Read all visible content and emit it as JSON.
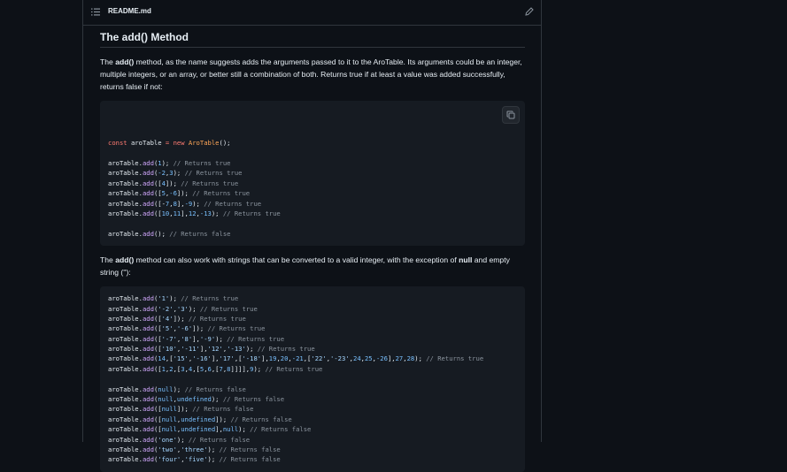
{
  "file": {
    "name": "README.md"
  },
  "section": {
    "title": "The add() Method",
    "para1": {
      "pre": "The ",
      "bold": "add()",
      "post": " method, as the name suggests adds the arguments passed to it to the AroTable. Its arguments could be an integer, multiple integers, or an array, or better still a combination of both. Returns true if at least a value was added successfully, returns false if not:"
    },
    "para2": {
      "pre": "The ",
      "bold": "add()",
      "mid": " method can also work with strings that can be converted to a valid integer, with the exception of ",
      "bold2": "null",
      "post": " and empty string (''):"
    }
  },
  "code1": [
    [
      [
        "k",
        "const"
      ],
      [
        "t",
        " aroTable "
      ],
      [
        "k",
        "="
      ],
      [
        "t",
        " "
      ],
      [
        "k",
        "new"
      ],
      [
        "t",
        " "
      ],
      [
        "cl",
        "AroTable"
      ],
      [
        "t",
        "();"
      ]
    ],
    [],
    [
      [
        "t",
        "aroTable."
      ],
      [
        "f",
        "add"
      ],
      [
        "t",
        "("
      ],
      [
        "n",
        "1"
      ],
      [
        "t",
        "); "
      ],
      [
        "c",
        "// Returns true"
      ]
    ],
    [
      [
        "t",
        "aroTable."
      ],
      [
        "f",
        "add"
      ],
      [
        "t",
        "("
      ],
      [
        "n",
        "-2"
      ],
      [
        "t",
        ","
      ],
      [
        "n",
        "3"
      ],
      [
        "t",
        "); "
      ],
      [
        "c",
        "// Returns true"
      ]
    ],
    [
      [
        "t",
        "aroTable."
      ],
      [
        "f",
        "add"
      ],
      [
        "t",
        "(["
      ],
      [
        "n",
        "4"
      ],
      [
        "t",
        "]); "
      ],
      [
        "c",
        "// Returns true"
      ]
    ],
    [
      [
        "t",
        "aroTable."
      ],
      [
        "f",
        "add"
      ],
      [
        "t",
        "(["
      ],
      [
        "n",
        "5"
      ],
      [
        "t",
        ","
      ],
      [
        "n",
        "-6"
      ],
      [
        "t",
        "]); "
      ],
      [
        "c",
        "// Returns true"
      ]
    ],
    [
      [
        "t",
        "aroTable."
      ],
      [
        "f",
        "add"
      ],
      [
        "t",
        "([-"
      ],
      [
        "n",
        "7"
      ],
      [
        "t",
        ","
      ],
      [
        "n",
        "8"
      ],
      [
        "t",
        "],"
      ],
      [
        "n",
        "-9"
      ],
      [
        "t",
        "); "
      ],
      [
        "c",
        "// Returns true"
      ]
    ],
    [
      [
        "t",
        "aroTable."
      ],
      [
        "f",
        "add"
      ],
      [
        "t",
        "(["
      ],
      [
        "n",
        "10"
      ],
      [
        "t",
        ","
      ],
      [
        "n",
        "11"
      ],
      [
        "t",
        "],"
      ],
      [
        "n",
        "12"
      ],
      [
        "t",
        ","
      ],
      [
        "n",
        "-13"
      ],
      [
        "t",
        "); "
      ],
      [
        "c",
        "// Returns true"
      ]
    ],
    [],
    [
      [
        "t",
        "aroTable."
      ],
      [
        "f",
        "add"
      ],
      [
        "t",
        "(); "
      ],
      [
        "c",
        "// Returns false"
      ]
    ]
  ],
  "code2": [
    [
      [
        "t",
        "aroTable."
      ],
      [
        "f",
        "add"
      ],
      [
        "t",
        "("
      ],
      [
        "s",
        "'1'"
      ],
      [
        "t",
        "); "
      ],
      [
        "c",
        "// Returns true"
      ]
    ],
    [
      [
        "t",
        "aroTable."
      ],
      [
        "f",
        "add"
      ],
      [
        "t",
        "("
      ],
      [
        "s",
        "'-2'"
      ],
      [
        "t",
        ","
      ],
      [
        "s",
        "'3'"
      ],
      [
        "t",
        "); "
      ],
      [
        "c",
        "// Returns true"
      ]
    ],
    [
      [
        "t",
        "aroTable."
      ],
      [
        "f",
        "add"
      ],
      [
        "t",
        "(["
      ],
      [
        "s",
        "'4'"
      ],
      [
        "t",
        "]); "
      ],
      [
        "c",
        "// Returns true"
      ]
    ],
    [
      [
        "t",
        "aroTable."
      ],
      [
        "f",
        "add"
      ],
      [
        "t",
        "(["
      ],
      [
        "s",
        "'5'"
      ],
      [
        "t",
        ","
      ],
      [
        "s",
        "'-6'"
      ],
      [
        "t",
        "]); "
      ],
      [
        "c",
        "// Returns true"
      ]
    ],
    [
      [
        "t",
        "aroTable."
      ],
      [
        "f",
        "add"
      ],
      [
        "t",
        "(["
      ],
      [
        "s",
        "'-7'"
      ],
      [
        "t",
        ","
      ],
      [
        "s",
        "'8'"
      ],
      [
        "t",
        "],"
      ],
      [
        "s",
        "'-9'"
      ],
      [
        "t",
        "); "
      ],
      [
        "c",
        "// Returns true"
      ]
    ],
    [
      [
        "t",
        "aroTable."
      ],
      [
        "f",
        "add"
      ],
      [
        "t",
        "(["
      ],
      [
        "s",
        "'10'"
      ],
      [
        "t",
        ","
      ],
      [
        "s",
        "'-11'"
      ],
      [
        "t",
        "],"
      ],
      [
        "s",
        "'12'"
      ],
      [
        "t",
        ","
      ],
      [
        "s",
        "'-13'"
      ],
      [
        "t",
        "); "
      ],
      [
        "c",
        "// Returns true"
      ]
    ],
    [
      [
        "t",
        "aroTable."
      ],
      [
        "f",
        "add"
      ],
      [
        "t",
        "("
      ],
      [
        "n",
        "14"
      ],
      [
        "t",
        ",["
      ],
      [
        "s",
        "'15'"
      ],
      [
        "t",
        ","
      ],
      [
        "s",
        "'-16'"
      ],
      [
        "t",
        "],"
      ],
      [
        "s",
        "'17'"
      ],
      [
        "t",
        ",["
      ],
      [
        "s",
        "'-18'"
      ],
      [
        "t",
        "],"
      ],
      [
        "n",
        "19"
      ],
      [
        "t",
        ","
      ],
      [
        "n",
        "20"
      ],
      [
        "t",
        ","
      ],
      [
        "n",
        "-21"
      ],
      [
        "t",
        ",["
      ],
      [
        "s",
        "'22'"
      ],
      [
        "t",
        ","
      ],
      [
        "s",
        "'-23'"
      ],
      [
        "t",
        ","
      ],
      [
        "n",
        "24"
      ],
      [
        "t",
        ","
      ],
      [
        "n",
        "25"
      ],
      [
        "t",
        ","
      ],
      [
        "n",
        "-26"
      ],
      [
        "t",
        "],"
      ],
      [
        "n",
        "27"
      ],
      [
        "t",
        ","
      ],
      [
        "n",
        "28"
      ],
      [
        "t",
        "); "
      ],
      [
        "c",
        "// Returns true"
      ]
    ],
    [
      [
        "t",
        "aroTable."
      ],
      [
        "f",
        "add"
      ],
      [
        "t",
        "(["
      ],
      [
        "n",
        "1"
      ],
      [
        "t",
        ","
      ],
      [
        "n",
        "2"
      ],
      [
        "t",
        ",["
      ],
      [
        "n",
        "3"
      ],
      [
        "t",
        ","
      ],
      [
        "n",
        "4"
      ],
      [
        "t",
        ",["
      ],
      [
        "n",
        "5"
      ],
      [
        "t",
        ","
      ],
      [
        "n",
        "6"
      ],
      [
        "t",
        ",["
      ],
      [
        "n",
        "7"
      ],
      [
        "t",
        ","
      ],
      [
        "n",
        "8"
      ],
      [
        "t",
        "]]]],"
      ],
      [
        "n",
        "9"
      ],
      [
        "t",
        "); "
      ],
      [
        "c",
        "// Returns true"
      ]
    ],
    [],
    [
      [
        "t",
        "aroTable."
      ],
      [
        "f",
        "add"
      ],
      [
        "t",
        "("
      ],
      [
        "n",
        "null"
      ],
      [
        "t",
        "); "
      ],
      [
        "c",
        "// Returns false"
      ]
    ],
    [
      [
        "t",
        "aroTable."
      ],
      [
        "f",
        "add"
      ],
      [
        "t",
        "("
      ],
      [
        "n",
        "null"
      ],
      [
        "t",
        ","
      ],
      [
        "n",
        "undefined"
      ],
      [
        "t",
        "); "
      ],
      [
        "c",
        "// Returns false"
      ]
    ],
    [
      [
        "t",
        "aroTable."
      ],
      [
        "f",
        "add"
      ],
      [
        "t",
        "(["
      ],
      [
        "n",
        "null"
      ],
      [
        "t",
        "]); "
      ],
      [
        "c",
        "// Returns false"
      ]
    ],
    [
      [
        "t",
        "aroTable."
      ],
      [
        "f",
        "add"
      ],
      [
        "t",
        "(["
      ],
      [
        "n",
        "null"
      ],
      [
        "t",
        ","
      ],
      [
        "n",
        "undefined"
      ],
      [
        "t",
        "]); "
      ],
      [
        "c",
        "// Returns false"
      ]
    ],
    [
      [
        "t",
        "aroTable."
      ],
      [
        "f",
        "add"
      ],
      [
        "t",
        "(["
      ],
      [
        "n",
        "null"
      ],
      [
        "t",
        ","
      ],
      [
        "n",
        "undefined"
      ],
      [
        "t",
        "],"
      ],
      [
        "n",
        "null"
      ],
      [
        "t",
        "); "
      ],
      [
        "c",
        "// Returns false"
      ]
    ],
    [
      [
        "t",
        "aroTable."
      ],
      [
        "f",
        "add"
      ],
      [
        "t",
        "("
      ],
      [
        "s",
        "'one'"
      ],
      [
        "t",
        "); "
      ],
      [
        "c",
        "// Returns false"
      ]
    ],
    [
      [
        "t",
        "aroTable."
      ],
      [
        "f",
        "add"
      ],
      [
        "t",
        "("
      ],
      [
        "s",
        "'two'"
      ],
      [
        "t",
        ","
      ],
      [
        "s",
        "'three'"
      ],
      [
        "t",
        "); "
      ],
      [
        "c",
        "// Returns false"
      ]
    ],
    [
      [
        "t",
        "aroTable."
      ],
      [
        "f",
        "add"
      ],
      [
        "t",
        "("
      ],
      [
        "s",
        "'four'"
      ],
      [
        "t",
        ","
      ],
      [
        "s",
        "'five'"
      ],
      [
        "t",
        "); "
      ],
      [
        "c",
        "// Returns false"
      ]
    ]
  ],
  "icons": {
    "list": "list-icon",
    "edit": "pencil-icon",
    "copy": "copy-icon"
  },
  "colors": {
    "background": "#0d1117",
    "code_background": "#161b22",
    "keyword": "#ff7b72",
    "function": "#d2a8ff",
    "number": "#79c0ff",
    "string": "#a5d6ff",
    "comment": "#8b949e",
    "class": "#ffa657"
  }
}
